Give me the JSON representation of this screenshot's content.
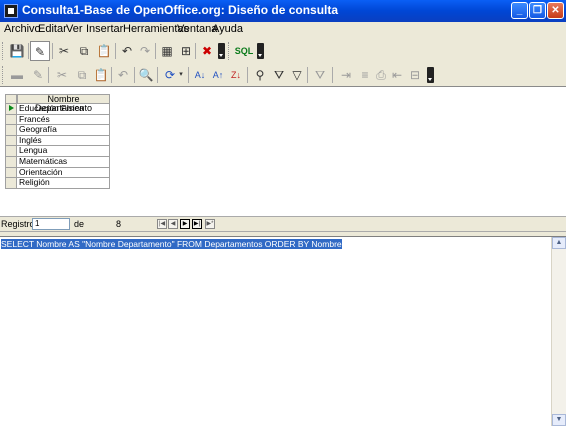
{
  "window": {
    "title": "Consulta1-Base de OpenOffice.org: Diseño de consulta"
  },
  "menu": [
    "Archivo",
    "Editar",
    "Ver",
    "Insertar",
    "Herramientas",
    "Ventana",
    "Ayuda"
  ],
  "toolbar1": {
    "icons": [
      "save-icon",
      "edit-mode-icon",
      "cut-icon",
      "copy-icon",
      "paste-icon",
      "undo-icon",
      "redo-icon",
      "add-table-icon",
      "design-view-icon",
      "clear-query-icon",
      "run-sql-icon"
    ],
    "sql_label": "SQL"
  },
  "toolbar2": {
    "icons": [
      "save-record-icon",
      "edit-data-icon",
      "cut-icon",
      "copy-icon",
      "paste-icon",
      "undo-icon",
      "find-record-icon",
      "refresh-icon",
      "sort-ascending-icon",
      "sort-descending-icon",
      "autofilter-icon",
      "standard-filter-icon",
      "apply-filter-icon",
      "remove-filter-icon"
    ]
  },
  "grid": {
    "column_header": "Nombre Departamento",
    "rows": [
      "Educación Física",
      "Francés",
      "Geografía",
      "Inglés",
      "Lengua",
      "Matemáticas",
      "Orientación",
      "Religión"
    ]
  },
  "navigator": {
    "record_label": "Registro",
    "current": "1",
    "of_label": "de",
    "total": "8"
  },
  "sql": {
    "text": "SELECT Nombre  AS \"Nombre Departamento\" FROM Departamentos ORDER BY Nombre"
  }
}
